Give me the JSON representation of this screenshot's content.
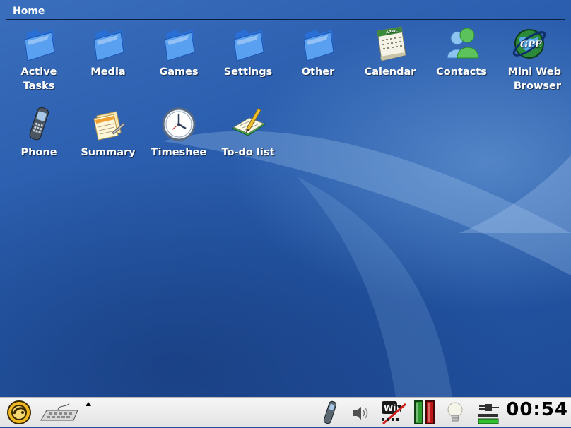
{
  "window": {
    "title": "Home"
  },
  "desktop_icons": [
    {
      "label": "Active\nTasks",
      "icon": "folder-icon"
    },
    {
      "label": "Media",
      "icon": "folder-icon"
    },
    {
      "label": "Games",
      "icon": "folder-icon"
    },
    {
      "label": "Settings",
      "icon": "folder-icon"
    },
    {
      "label": "Other",
      "icon": "folder-icon"
    },
    {
      "label": "Calendar",
      "icon": "calendar-icon"
    },
    {
      "label": "Contacts",
      "icon": "contacts-icon"
    },
    {
      "label": "Mini Web\nBrowser",
      "icon": "browser-globe-icon"
    },
    {
      "label": "Phone",
      "icon": "phone-icon"
    },
    {
      "label": "Summary",
      "icon": "summary-notes-icon"
    },
    {
      "label": "Timeshee",
      "icon": "clock-icon"
    },
    {
      "label": "To-do list",
      "icon": "todo-notebook-icon"
    }
  ],
  "calendar_icon_month": "APRIL",
  "browser_icon_text": "GPE",
  "taskbar": {
    "clock": "00:54",
    "wifi_badge": "Wi"
  },
  "colors": {
    "desktop_blue": "#2b5eae",
    "taskbar_bg": "#ececec",
    "battery_green": "#2e9a2e",
    "battery_red": "#c01818"
  }
}
